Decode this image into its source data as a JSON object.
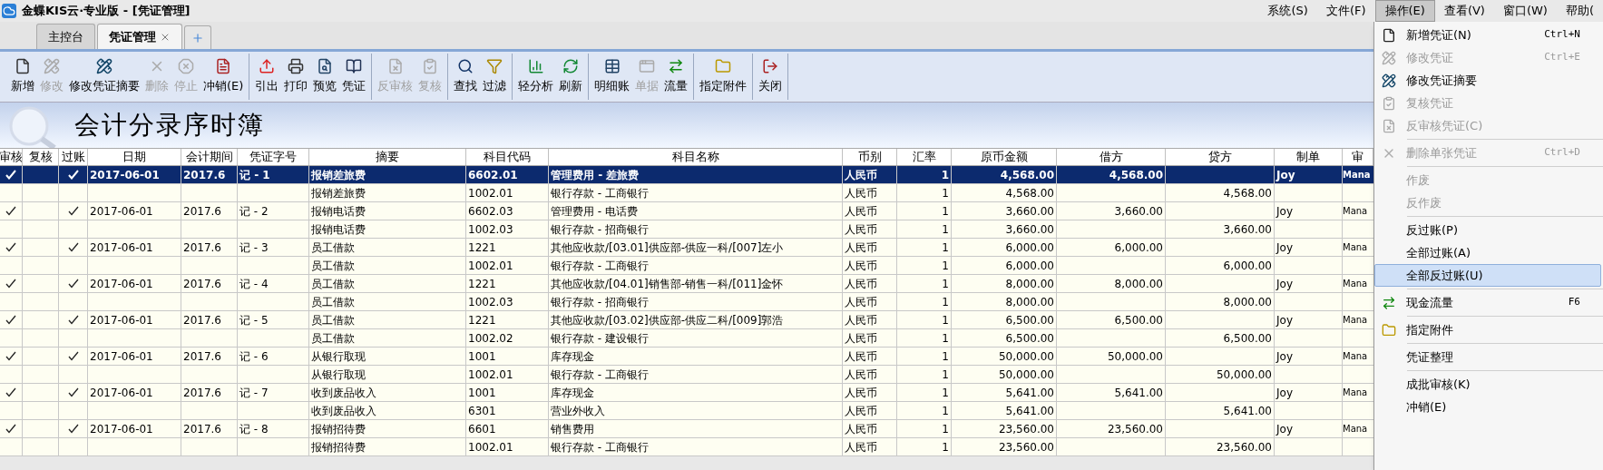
{
  "window": {
    "title": "金蝶KIS云·专业版 - [凭证管理]"
  },
  "menubar": [
    {
      "label": "系统(S)",
      "selected": false
    },
    {
      "label": "文件(F)",
      "selected": false
    },
    {
      "label": "操作(E)",
      "selected": true
    },
    {
      "label": "查看(V)",
      "selected": false
    },
    {
      "label": "窗口(W)",
      "selected": false
    },
    {
      "label": "帮助(",
      "selected": false
    }
  ],
  "tabs": [
    {
      "label": "主控台",
      "selected": false,
      "closable": false
    },
    {
      "label": "凭证管理",
      "selected": true,
      "closable": true
    }
  ],
  "toolbar": [
    [
      {
        "label": "新增",
        "disabled": false
      },
      {
        "label": "修改",
        "disabled": true
      },
      {
        "label": "修改凭证摘要",
        "disabled": false
      },
      {
        "label": "删除",
        "disabled": true
      },
      {
        "label": "停止",
        "disabled": true
      },
      {
        "label": "冲销(E)",
        "disabled": false
      }
    ],
    [
      {
        "label": "引出",
        "disabled": false
      },
      {
        "label": "打印",
        "disabled": false
      },
      {
        "label": "预览",
        "disabled": false
      },
      {
        "label": "凭证",
        "disabled": false
      }
    ],
    [
      {
        "label": "反审核",
        "disabled": true
      },
      {
        "label": "复核",
        "disabled": true
      }
    ],
    [
      {
        "label": "查找",
        "disabled": false
      },
      {
        "label": "过滤",
        "disabled": false
      }
    ],
    [
      {
        "label": "轻分析",
        "disabled": false
      },
      {
        "label": "刷新",
        "disabled": false
      }
    ],
    [
      {
        "label": "明细账",
        "disabled": false
      },
      {
        "label": "单据",
        "disabled": true
      },
      {
        "label": "流量",
        "disabled": false
      }
    ],
    [
      {
        "label": "指定附件",
        "disabled": false
      }
    ],
    [
      {
        "label": "关闭",
        "disabled": false
      }
    ]
  ],
  "page_title": "会计分录序时簿",
  "table": {
    "columns": [
      "审核",
      "复核",
      "过账",
      "日期",
      "会计期间",
      "凭证字号",
      "摘要",
      "科目代码",
      "科目名称",
      "币别",
      "汇率",
      "原币金额",
      "借方",
      "贷方",
      "制单",
      "审"
    ],
    "rows": [
      {
        "selected": true,
        "audited": true,
        "posted": true,
        "date": "2017-06-01",
        "period": "2017.6",
        "voucher_no": "记 - 1",
        "summary": "报销差旅费",
        "account_code": "6602.01",
        "account_name": "管理费用 - 差旅费",
        "currency": "人民币",
        "rate": "1",
        "amount": "4,568.00",
        "debit": "4,568.00",
        "preparer": "Joy",
        "auditor": "Mana"
      },
      {
        "selected": false,
        "summary": "报销差旅费",
        "account_code": "1002.01",
        "account_name": "银行存款 - 工商银行",
        "currency": "人民币",
        "rate": "1",
        "amount": "4,568.00",
        "credit": "4,568.00"
      },
      {
        "selected": false,
        "audited": true,
        "posted": true,
        "date": "2017-06-01",
        "period": "2017.6",
        "voucher_no": "记 - 2",
        "summary": "报销电话费",
        "account_code": "6602.03",
        "account_name": "管理费用 - 电话费",
        "currency": "人民币",
        "rate": "1",
        "amount": "3,660.00",
        "debit": "3,660.00",
        "preparer": "Joy",
        "auditor": "Mana"
      },
      {
        "selected": false,
        "summary": "报销电话费",
        "account_code": "1002.03",
        "account_name": "银行存款 - 招商银行",
        "currency": "人民币",
        "rate": "1",
        "amount": "3,660.00",
        "credit": "3,660.00"
      },
      {
        "selected": false,
        "audited": true,
        "posted": true,
        "date": "2017-06-01",
        "period": "2017.6",
        "voucher_no": "记 - 3",
        "summary": "员工借款",
        "account_code": "1221",
        "account_name": "其他应收款/[03.01]供应部-供应一科/[007]左小",
        "currency": "人民币",
        "rate": "1",
        "amount": "6,000.00",
        "debit": "6,000.00",
        "preparer": "Joy",
        "auditor": "Mana"
      },
      {
        "selected": false,
        "summary": "员工借款",
        "account_code": "1002.01",
        "account_name": "银行存款 - 工商银行",
        "currency": "人民币",
        "rate": "1",
        "amount": "6,000.00",
        "credit": "6,000.00"
      },
      {
        "selected": false,
        "audited": true,
        "posted": true,
        "date": "2017-06-01",
        "period": "2017.6",
        "voucher_no": "记 - 4",
        "summary": "员工借款",
        "account_code": "1221",
        "account_name": "其他应收款/[04.01]销售部-销售一科/[011]金怀",
        "currency": "人民币",
        "rate": "1",
        "amount": "8,000.00",
        "debit": "8,000.00",
        "preparer": "Joy",
        "auditor": "Mana"
      },
      {
        "selected": false,
        "summary": "员工借款",
        "account_code": "1002.03",
        "account_name": "银行存款 - 招商银行",
        "currency": "人民币",
        "rate": "1",
        "amount": "8,000.00",
        "credit": "8,000.00"
      },
      {
        "selected": false,
        "audited": true,
        "posted": true,
        "date": "2017-06-01",
        "period": "2017.6",
        "voucher_no": "记 - 5",
        "summary": "员工借款",
        "account_code": "1221",
        "account_name": "其他应收款/[03.02]供应部-供应二科/[009]郭浩",
        "currency": "人民币",
        "rate": "1",
        "amount": "6,500.00",
        "debit": "6,500.00",
        "preparer": "Joy",
        "auditor": "Mana"
      },
      {
        "selected": false,
        "summary": "员工借款",
        "account_code": "1002.02",
        "account_name": "银行存款 - 建设银行",
        "currency": "人民币",
        "rate": "1",
        "amount": "6,500.00",
        "credit": "6,500.00"
      },
      {
        "selected": false,
        "audited": true,
        "posted": true,
        "date": "2017-06-01",
        "period": "2017.6",
        "voucher_no": "记 - 6",
        "summary": "从银行取现",
        "account_code": "1001",
        "account_name": "库存现金",
        "currency": "人民币",
        "rate": "1",
        "amount": "50,000.00",
        "debit": "50,000.00",
        "preparer": "Joy",
        "auditor": "Mana"
      },
      {
        "selected": false,
        "summary": "从银行取现",
        "account_code": "1002.01",
        "account_name": "银行存款 - 工商银行",
        "currency": "人民币",
        "rate": "1",
        "amount": "50,000.00",
        "credit": "50,000.00"
      },
      {
        "selected": false,
        "audited": true,
        "posted": true,
        "date": "2017-06-01",
        "period": "2017.6",
        "voucher_no": "记 - 7",
        "summary": "收到废品收入",
        "account_code": "1001",
        "account_name": "库存现金",
        "currency": "人民币",
        "rate": "1",
        "amount": "5,641.00",
        "debit": "5,641.00",
        "preparer": "Joy",
        "auditor": "Mana"
      },
      {
        "selected": false,
        "summary": "收到废品收入",
        "account_code": "6301",
        "account_name": "营业外收入",
        "currency": "人民币",
        "rate": "1",
        "amount": "5,641.00",
        "credit": "5,641.00"
      },
      {
        "selected": false,
        "audited": true,
        "posted": true,
        "date": "2017-06-01",
        "period": "2017.6",
        "voucher_no": "记 - 8",
        "summary": "报销招待费",
        "account_code": "6601",
        "account_name": "销售费用",
        "currency": "人民币",
        "rate": "1",
        "amount": "23,560.00",
        "debit": "23,560.00",
        "preparer": "Joy",
        "auditor": "Mana"
      },
      {
        "selected": false,
        "summary": "报销招待费",
        "account_code": "1002.01",
        "account_name": "银行存款 - 工商银行",
        "currency": "人民币",
        "rate": "1",
        "amount": "23,560.00",
        "credit": "23,560.00"
      }
    ]
  },
  "menu": {
    "groups": [
      [
        {
          "label": "新增凭证(N)",
          "shortcut": "Ctrl+N",
          "disabled": false,
          "selected": false
        },
        {
          "label": "修改凭证",
          "shortcut": "Ctrl+E",
          "disabled": true,
          "selected": false
        },
        {
          "label": "修改凭证摘要",
          "disabled": false,
          "selected": false
        },
        {
          "label": "复核凭证",
          "disabled": true,
          "selected": false
        },
        {
          "label": "反审核凭证(C)",
          "disabled": true,
          "selected": false
        }
      ],
      [
        {
          "label": "删除单张凭证",
          "shortcut": "Ctrl+D",
          "disabled": true,
          "selected": false
        }
      ],
      [
        {
          "label": "作废",
          "disabled": true,
          "selected": false
        },
        {
          "label": "反作废",
          "disabled": true,
          "selected": false
        }
      ],
      [
        {
          "label": "反过账(P)",
          "disabled": false,
          "selected": false
        },
        {
          "label": "全部过账(A)",
          "disabled": false,
          "selected": false
        },
        {
          "label": "全部反过账(U)",
          "disabled": false,
          "selected": true
        }
      ],
      [
        {
          "label": "现金流量",
          "shortcut": "F6",
          "disabled": false,
          "selected": false
        }
      ],
      [
        {
          "label": "指定附件",
          "disabled": false,
          "selected": false
        }
      ],
      [
        {
          "label": "凭证整理",
          "disabled": false,
          "selected": false
        }
      ],
      [
        {
          "label": "成批审核(K)",
          "disabled": false,
          "selected": false
        },
        {
          "label": "冲销(E)",
          "disabled": false,
          "selected": false
        }
      ]
    ]
  }
}
